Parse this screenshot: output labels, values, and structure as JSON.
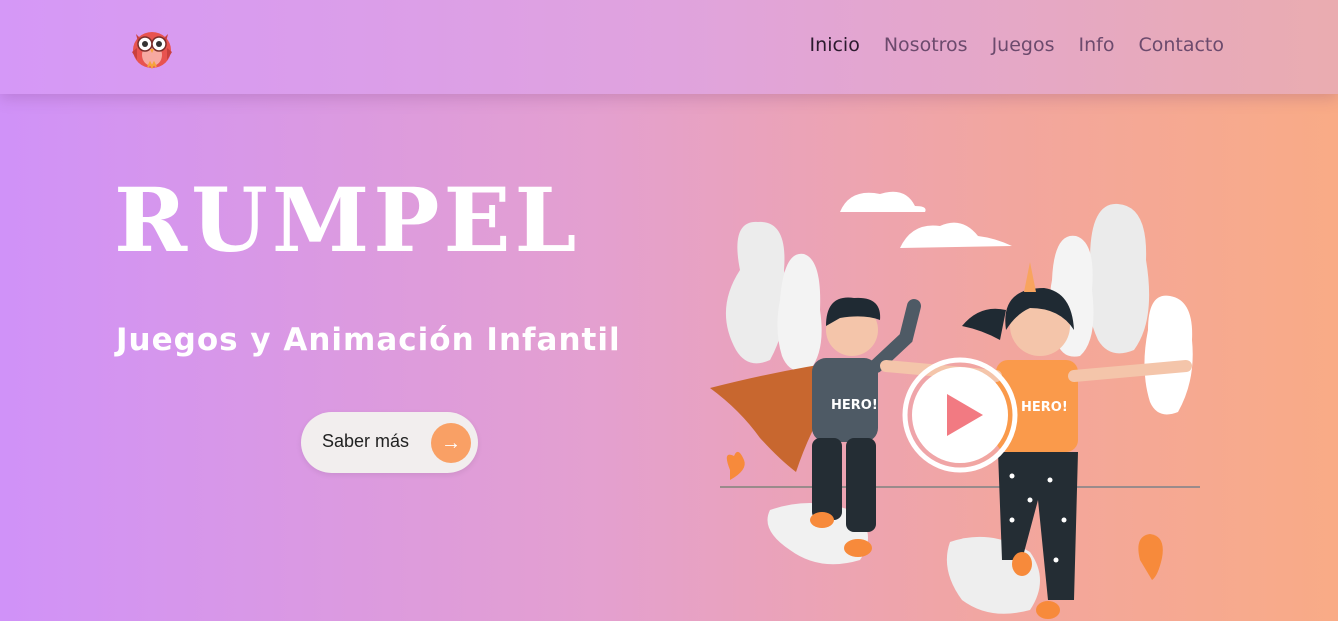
{
  "brand": {
    "logo_icon": "owl-logo-icon"
  },
  "nav": {
    "items": [
      {
        "label": "Inicio",
        "active": true
      },
      {
        "label": "Nosotros",
        "active": false
      },
      {
        "label": "Juegos",
        "active": false
      },
      {
        "label": "Info",
        "active": false
      },
      {
        "label": "Contacto",
        "active": false
      }
    ]
  },
  "hero": {
    "title": "RUMPEL",
    "subtitle": "Juegos y Animación Infantil",
    "cta_label": "Saber más",
    "cta_icon": "arrow-right-icon"
  },
  "illustration": {
    "shirt_text": "HERO!",
    "play_icon": "play-icon"
  },
  "colors": {
    "accent": "#f9a065",
    "gradient_start": "#d092f8",
    "gradient_end": "#f9ab86"
  }
}
